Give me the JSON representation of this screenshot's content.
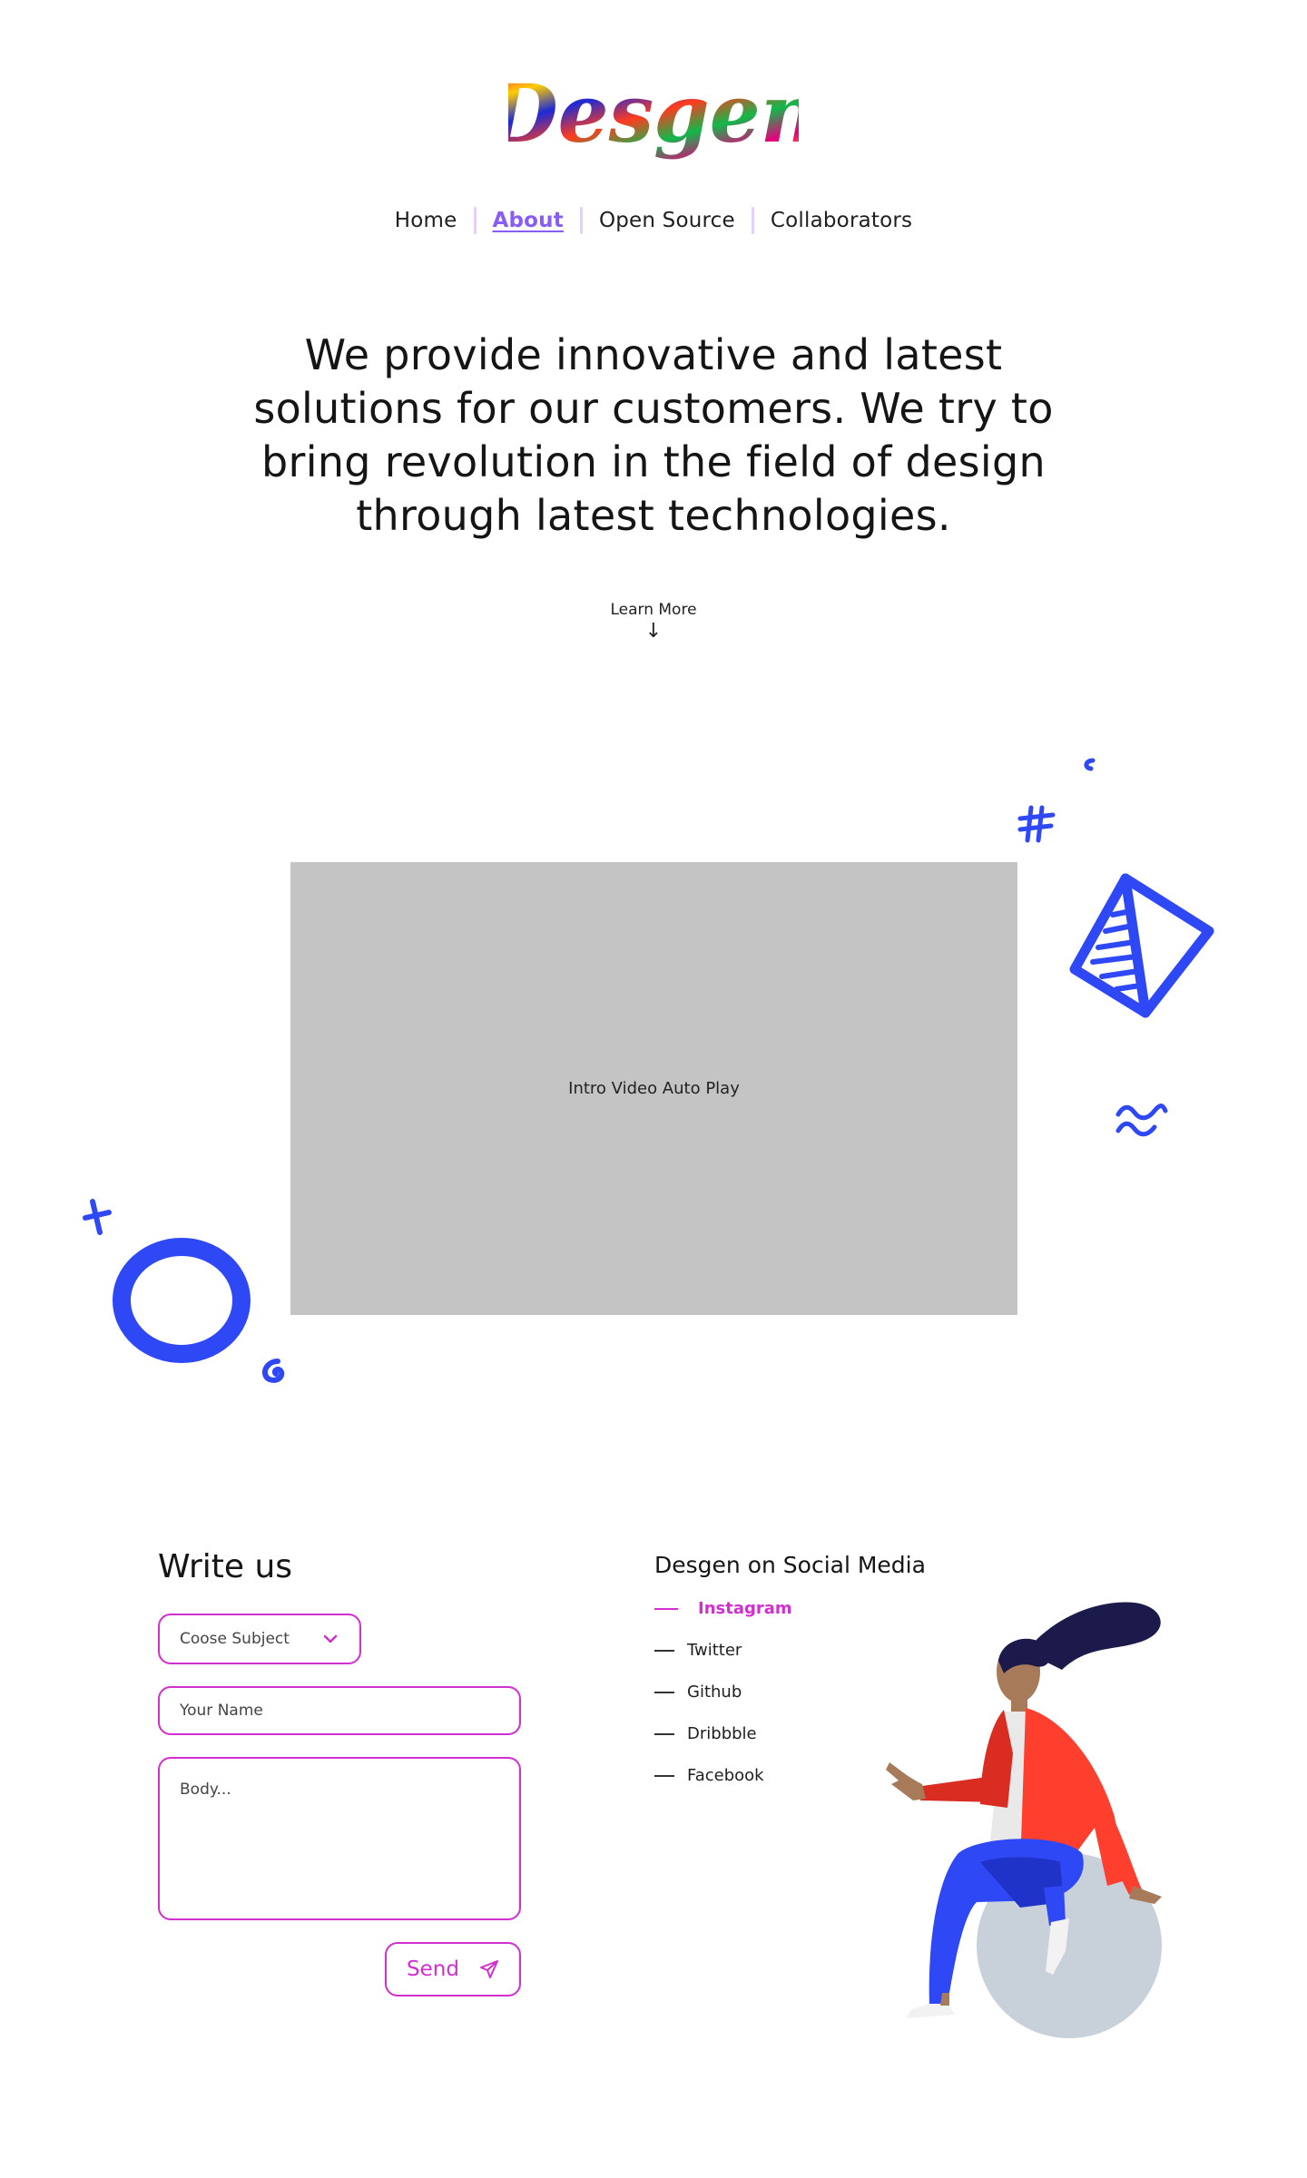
{
  "brand": {
    "name": "Desgen"
  },
  "nav": {
    "items": [
      {
        "label": "Home",
        "active": false
      },
      {
        "label": "About",
        "active": true
      },
      {
        "label": "Open Source",
        "active": false
      },
      {
        "label": "Collaborators",
        "active": false
      }
    ],
    "active_color": "#8a5cf6"
  },
  "hero": {
    "text": "We provide innovative and latest solutions for our customers. We try to bring revolution in the field of design through latest technologies.",
    "learn_more": "Learn More",
    "learn_more_arrow": "↓"
  },
  "video": {
    "placeholder": "Intro Video Auto Play"
  },
  "contact": {
    "title": "Write us",
    "subject_label": "Coose Subject",
    "name_placeholder": "Your Name",
    "body_placeholder": "Body...",
    "send_label": "Send",
    "accent": "#d12fcf"
  },
  "social": {
    "title": "Desgen on Social Media",
    "items": [
      {
        "label": "Instagram",
        "active": true
      },
      {
        "label": "Twitter",
        "active": false
      },
      {
        "label": "Github",
        "active": false
      },
      {
        "label": "Dribbble",
        "active": false
      },
      {
        "label": "Facebook",
        "active": false
      }
    ]
  },
  "colors": {
    "doodle": "#2f48f5",
    "video_bg": "#c4c4c4"
  }
}
